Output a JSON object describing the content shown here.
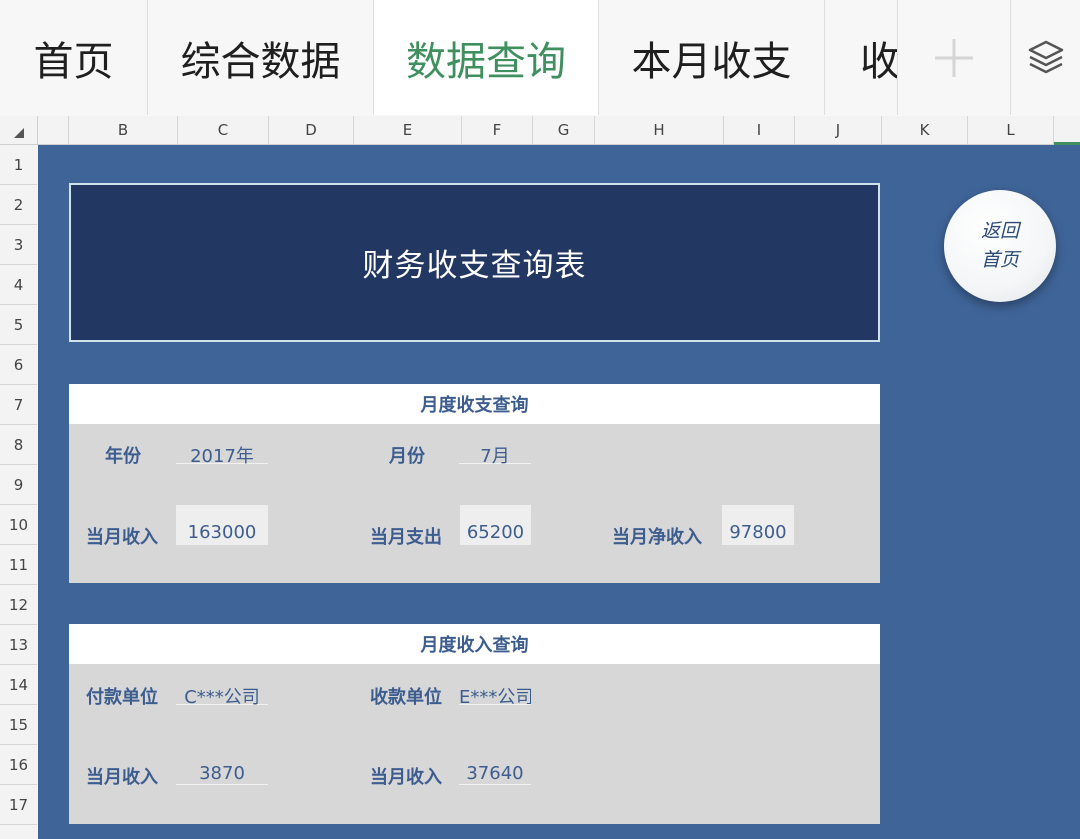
{
  "tabs": [
    {
      "label": "首页",
      "active": false
    },
    {
      "label": "综合数据",
      "active": false
    },
    {
      "label": "数据查询",
      "active": true
    },
    {
      "label": "本月收支",
      "active": false
    },
    {
      "label": "收",
      "active": false
    }
  ],
  "icons": {
    "add": "plus-icon",
    "layers": "layers-icon",
    "corner": "select-all-triangle-icon"
  },
  "columns": [
    "B",
    "C",
    "D",
    "E",
    "F",
    "G",
    "H",
    "I",
    "J",
    "K",
    "L"
  ],
  "rows": [
    "1",
    "2",
    "3",
    "4",
    "5",
    "6",
    "7",
    "8",
    "9",
    "10",
    "11",
    "12",
    "13",
    "14",
    "15",
    "16",
    "17"
  ],
  "title": "财务收支查询表",
  "home_button": {
    "line1": "返回",
    "line2": "首页"
  },
  "monthly_summary": {
    "header": "月度收支查询",
    "year_label": "年份",
    "year_value": "2017年",
    "month_label": "月份",
    "month_value": "7月",
    "income_label": "当月收入",
    "income_value": "163000",
    "expense_label": "当月支出",
    "expense_value": "65200",
    "net_label": "当月净收入",
    "net_value": "97800"
  },
  "income_query": {
    "header": "月度收入查询",
    "payer_label": "付款单位",
    "payer_value": "C***公司",
    "payee_label": "收款单位",
    "payee_value": "E***公司",
    "income1_label": "当月收入",
    "income1_value": "3870",
    "income2_label": "当月收入",
    "income2_value": "37640"
  },
  "colors": {
    "sheet_bg": "#3f6498",
    "title_bg": "#233763",
    "panel_bg": "#d7d7d7",
    "label_text": "#3d5d8f",
    "active_tab": "#3f8f5f"
  }
}
